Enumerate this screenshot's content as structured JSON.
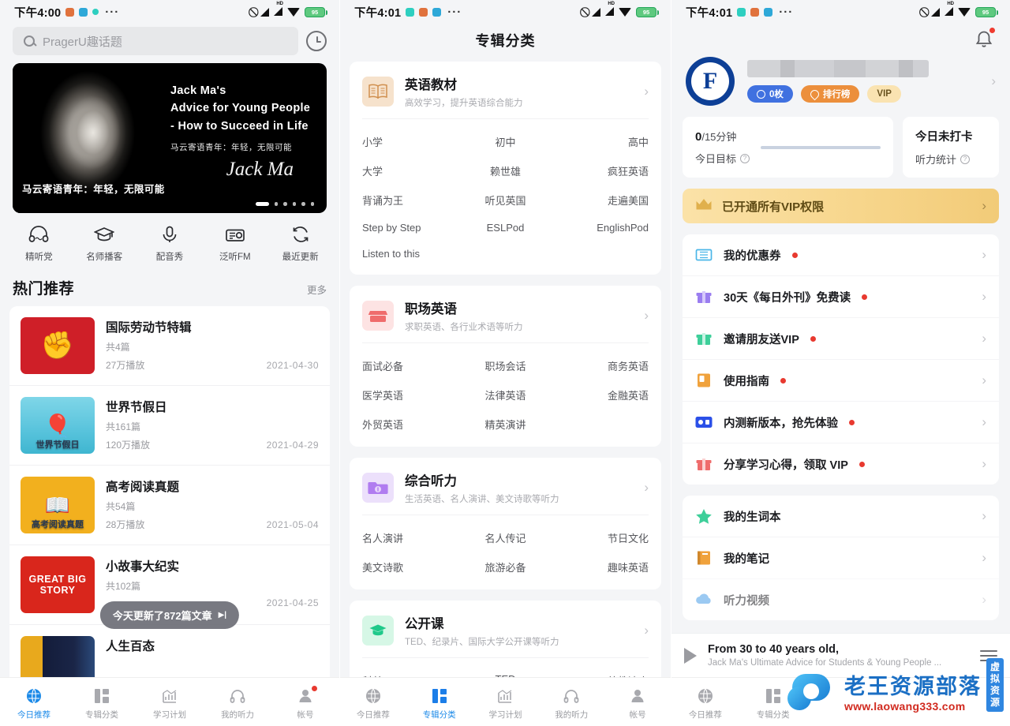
{
  "status_bar": {
    "time_left": "下午4:00",
    "time_mid": "下午4:01",
    "time_right": "下午4:01",
    "more_dots": "···",
    "battery": "95",
    "signal_label": "HD"
  },
  "panel1": {
    "search": {
      "placeholder": "PragerU趣话题",
      "icon": "search-icon",
      "history_icon": "clock-icon"
    },
    "banner": {
      "line1": "Jack Ma's",
      "line2": "Advice for Young People",
      "line3": "- How to Succeed in Life",
      "subtitle_cn": "马云寄语青年：年轻，无限可能",
      "signature": "Jack Ma",
      "caption": "马云寄语青年：年轻，无限可能",
      "dots_total": 6,
      "dot_active": 0
    },
    "quicknav": [
      {
        "label": "精听党",
        "icon": "headphones-icon"
      },
      {
        "label": "名师播客",
        "icon": "graduation-cap-icon"
      },
      {
        "label": "配音秀",
        "icon": "microphone-icon"
      },
      {
        "label": "泛听FM",
        "icon": "radio-icon"
      },
      {
        "label": "最近更新",
        "icon": "refresh-icon"
      }
    ],
    "section": {
      "title": "热门推荐",
      "more": "更多"
    },
    "items": [
      {
        "title": "国际劳动节特辑",
        "count": "共4篇",
        "plays": "27万播放",
        "date": "2021-04-30",
        "thumb": "labor",
        "thumb_text": ""
      },
      {
        "title": "世界节假日",
        "count": "共161篇",
        "plays": "120万播放",
        "date": "2021-04-29",
        "thumb": "holiday",
        "thumb_text": "世界节假日"
      },
      {
        "title": "高考阅读真题",
        "count": "共54篇",
        "plays": "28万播放",
        "date": "2021-05-04",
        "thumb": "gaokao",
        "thumb_text": "高考阅读真题"
      },
      {
        "title": "小故事大纪实",
        "count": "共102篇",
        "plays": "",
        "date": "2021-04-25",
        "thumb": "gbs",
        "thumb_text": "GREAT BIG STORY"
      }
    ],
    "toast": {
      "text": "今天更新了872篇文章",
      "arrow": "▶|"
    },
    "tabbar": [
      {
        "label": "今日推荐",
        "icon": "globe-icon",
        "active": true,
        "dot": false
      },
      {
        "label": "专辑分类",
        "icon": "grid-icon",
        "active": false,
        "dot": false
      },
      {
        "label": "学习计划",
        "icon": "chart-icon",
        "active": false,
        "dot": false
      },
      {
        "label": "我的听力",
        "icon": "headphones-icon",
        "active": false,
        "dot": false
      },
      {
        "label": "帐号",
        "icon": "person-icon",
        "active": false,
        "dot": true
      }
    ]
  },
  "panel2": {
    "title": "专辑分类",
    "categories": [
      {
        "name": "英语教材",
        "desc": "高效学习，提升英语综合能力",
        "icon": "book-icon",
        "icon_style": "book",
        "tags": [
          "小学",
          "初中",
          "高中",
          "大学",
          "赖世雄",
          "疯狂英语",
          "背诵为王",
          "听见英国",
          "走遍美国",
          "Step by Step",
          "ESLPod",
          "EnglishPod",
          "Listen to this"
        ]
      },
      {
        "name": "职场英语",
        "desc": "求职英语、各行业术语等听力",
        "icon": "store-icon",
        "icon_style": "shop",
        "tags": [
          "面试必备",
          "职场会话",
          "商务英语",
          "医学英语",
          "法律英语",
          "金融英语",
          "外贸英语",
          "精英演讲"
        ]
      },
      {
        "name": "综合听力",
        "desc": "生活英语、名人演讲、美文诗歌等听力",
        "icon": "folder-icon",
        "icon_style": "folder",
        "tags": [
          "名人演讲",
          "名人传记",
          "节日文化",
          "美文诗歌",
          "旅游必备",
          "趣味英语"
        ]
      },
      {
        "name": "公开课",
        "desc": "TED、纪录片、国际大学公开课等听力",
        "icon": "graduation-cap-icon",
        "icon_style": "cap",
        "tags": [
          "科普",
          "TED",
          "外教达人"
        ]
      }
    ],
    "tabbar": [
      {
        "label": "今日推荐",
        "icon": "globe-icon",
        "active": false,
        "dot": false
      },
      {
        "label": "专辑分类",
        "icon": "grid-icon",
        "active": true,
        "dot": false
      },
      {
        "label": "学习计划",
        "icon": "chart-icon",
        "active": false,
        "dot": false
      },
      {
        "label": "我的听力",
        "icon": "headphones-icon",
        "active": false,
        "dot": false
      },
      {
        "label": "帐号",
        "icon": "person-icon",
        "active": false,
        "dot": false
      }
    ]
  },
  "panel3": {
    "bell_icon": "bell-icon",
    "avatar_letter": "F",
    "badges": [
      {
        "label": "0枚",
        "style": "coin"
      },
      {
        "label": "排行榜",
        "style": "rank"
      },
      {
        "label": "VIP",
        "style": "vip"
      }
    ],
    "stat_goal": {
      "value": "0",
      "unit": "/15分钟",
      "label": "今日目标"
    },
    "stat_checkin": {
      "value": "今日未打卡",
      "label": "听力统计"
    },
    "vip_bar": {
      "text": "已开通所有VIP权限",
      "icon": "crown-icon"
    },
    "menu_group1": [
      {
        "label": "我的优惠券",
        "icon": "ticket-icon",
        "dot": true
      },
      {
        "label": "30天《每日外刊》免费读",
        "icon": "gift-icon",
        "dot": true
      },
      {
        "label": "邀请朋友送VIP",
        "icon": "gift-green-icon",
        "dot": true
      },
      {
        "label": "使用指南",
        "icon": "guide-icon",
        "dot": true
      },
      {
        "label": "内测新版本，抢先体验",
        "icon": "beta-icon",
        "dot": true
      },
      {
        "label": "分享学习心得，领取 VIP",
        "icon": "gift-red-icon",
        "dot": true
      }
    ],
    "menu_group2": [
      {
        "label": "我的生词本",
        "icon": "star-icon",
        "dot": false
      },
      {
        "label": "我的笔记",
        "icon": "notebook-icon",
        "dot": false
      }
    ],
    "player": {
      "title": "From 30 to 40 years old,",
      "subtitle": "Jack Ma's Ultimate Advice for Students & Young People ...",
      "play_icon": "play-icon",
      "menu_icon": "playlist-icon"
    },
    "tabbar": [
      {
        "label": "今日推荐",
        "icon": "globe-icon",
        "active": false,
        "dot": false
      },
      {
        "label": "专辑分类",
        "icon": "grid-icon",
        "active": false,
        "dot": false
      }
    ]
  },
  "watermark": {
    "main": "老王资源部落",
    "url": "www.laowang333.com",
    "side": "虚拟资源"
  }
}
